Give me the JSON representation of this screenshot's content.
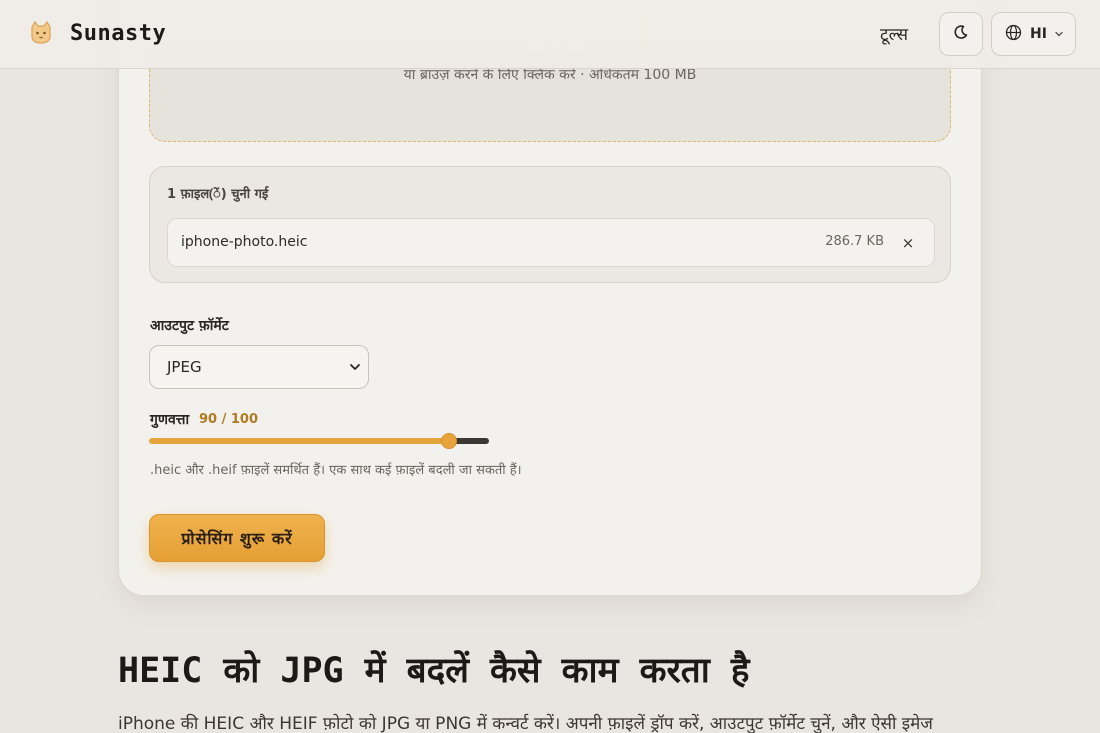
{
  "header": {
    "brand": "Sunasty",
    "nav_tools": "टूल्स",
    "language_label": "HI"
  },
  "dropzone": {
    "subtext": "या ब्राउज़ करने के लिए क्लिक करें · अधिकतम 100 MB"
  },
  "files": {
    "count_label": "1 फ़ाइल(ें) चुनी गई",
    "items": [
      {
        "name": "iphone-photo.heic",
        "size": "286.7 KB",
        "remove": "×"
      }
    ]
  },
  "output_format": {
    "label": "आउटपुट फ़ॉर्मेट",
    "selected": "JPEG"
  },
  "quality": {
    "label": "गुणवत्ता",
    "value_text": "90 / 100",
    "value": 90,
    "max": 100
  },
  "hint": ".heic और .heif फ़ाइलें समर्थित हैं। एक साथ कई फ़ाइलें बदली जा सकती हैं।",
  "start_button": "प्रोसेसिंग शुरू करें",
  "section": {
    "heading": "HEIC को JPG में बदलें कैसे काम करता है",
    "intro": "iPhone की HEIC और HEIF फ़ोटो को JPG या PNG में कन्वर्ट करें। अपनी फ़ाइलें ड्रॉप करें, आउटपुट फ़ॉर्मेट चुनें, और ऐसी इमेज"
  },
  "colors": {
    "accent": "#e8a43c",
    "background": "#e9e6e1",
    "card": "#f3f1ed"
  }
}
